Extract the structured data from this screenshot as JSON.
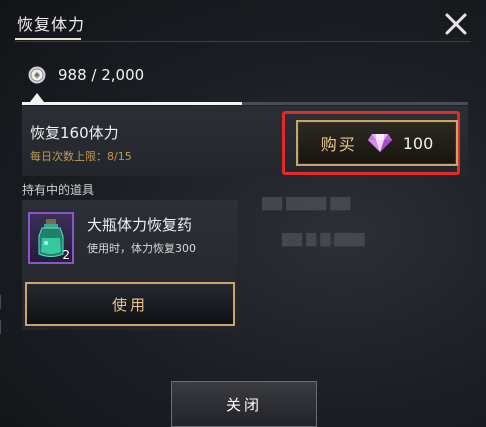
{
  "dialog": {
    "title": "恢复体力"
  },
  "stamina": {
    "icon": "stamina-coin-icon",
    "display": "988 / 2,000",
    "current": 988,
    "max": 2000
  },
  "recover": {
    "label": "恢复160体力",
    "daily_limit": "每日次数上限：8/15",
    "buy_label": "购买",
    "price_icon": "diamond-gem-icon",
    "price": "100",
    "highlight_color": "#e12c25"
  },
  "owned": {
    "header": "持有中的道具",
    "items": [
      {
        "icon": "potion-bottle-icon",
        "count": "2",
        "name": "大瓶体力恢复药",
        "description": "使用时，体力恢复300",
        "use_label": "使用"
      }
    ]
  },
  "footer": {
    "close_label": "关闭"
  },
  "colors": {
    "accent_gold": "#c9a667",
    "gold_text": "#e9c58c",
    "rarity_purple": "#8a55c9"
  }
}
